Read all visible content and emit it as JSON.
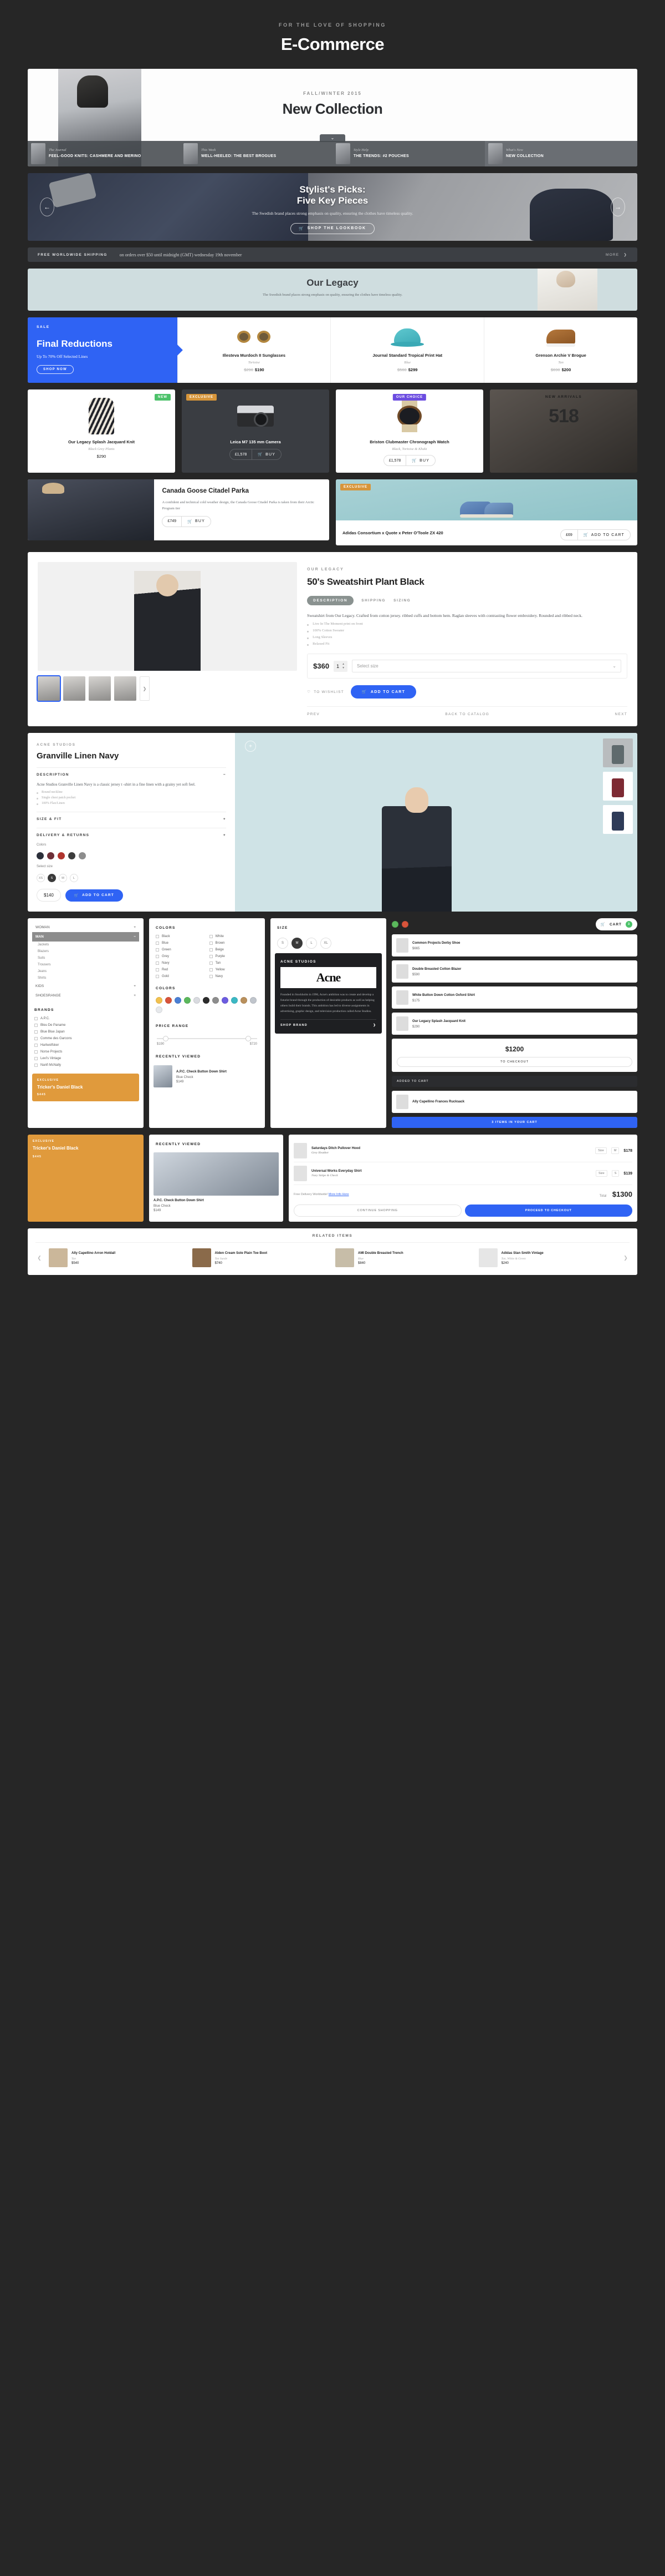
{
  "header": {
    "kicker": "FOR THE LOVE OF SHOPPING",
    "title": "E-Commerce"
  },
  "hero": {
    "kicker": "FALL/WINTER 2015",
    "title": "New Collection",
    "chevron": "⌄",
    "cards": [
      {
        "kicker": "The Journal",
        "title": "FEEL-GOOD KNITS: CASHMERE AND MERINO"
      },
      {
        "kicker": "This Week",
        "title": "WELL-HEELED: THE BEST BROGUES"
      },
      {
        "kicker": "Style Help",
        "title": "THE TRENDS: #2 POUCHES"
      },
      {
        "kicker": "What's New",
        "title": "NEW COLLECTION"
      }
    ]
  },
  "slider": {
    "title_line1": "Stylist's Picks:",
    "title_line2": "Five Key Pieces",
    "body": "The Swedish brand places strong emphasis on quality, ensuring the clothes have timeless quality.",
    "button": "SHOP THE LOOKBOOK",
    "prev": "←",
    "next": "→"
  },
  "shipping": {
    "strong": "FREE WORLDWIDE SHIPPING",
    "text": "on orders over $50 until midnight (GMT) wednesday 19th november",
    "more": "MORE",
    "more_icon": "❯"
  },
  "legacy": {
    "title": "Our Legacy",
    "body": "The Swedish brand places strong emphasis on quality, ensuring the clothes have timeless quality."
  },
  "sale": {
    "tag": "SALE",
    "title": "Final Reductions",
    "subtitle": "Up To 70% Off Selected Lines",
    "button": "SHOP NOW",
    "items": [
      {
        "name": "Illesteva Murdoch II Sunglasses",
        "color": "Tortoise",
        "old": "$290",
        "price": "$190"
      },
      {
        "name": "Journal Standard Tropical Print Hat",
        "color": "Blue",
        "old": "$560",
        "price": "$299"
      },
      {
        "name": "Grenson Archie V Brogue",
        "color": "Tan",
        "old": "$690",
        "price": "$200"
      }
    ]
  },
  "grid": {
    "items": [
      {
        "badge": "NEW",
        "name": "Our Legacy Splash Jacquard Knit",
        "color": "Black Grey Plants",
        "price": "$290"
      },
      {
        "badge": "EXCLUSIVE",
        "name": "Leica M7 135 mm Camera",
        "price": "£1,578",
        "buy": "BUY"
      },
      {
        "badge": "OUR CHOICE",
        "name": "Briston Clubmaster Chronograph Watch",
        "color": "Black, Tortoise & Khaki",
        "price": "£1,578",
        "buy": "BUY"
      },
      {
        "badge": "NEW ARRIVALS",
        "number": "518"
      }
    ]
  },
  "features": {
    "parka": {
      "title": "Canada Goose Citadel Parka",
      "body": "A confident and technical cold weather design, the Canada Goose Citadel Parka is taken from their Arctic Program tier",
      "price": "£749",
      "buy": "BUY"
    },
    "adidas": {
      "badge": "EXCLUSIVE",
      "name": "Adidas Consortium x Quote x Peter O'Toole ZX 420",
      "price": "£69",
      "button": "ADD TO CART"
    }
  },
  "detail": {
    "kicker": "OUR LEGACY",
    "title": "50's Sweatshirt Plant Black",
    "tabs": [
      "DESCRIPTION",
      "SHIPPING",
      "SIZING"
    ],
    "description": "Sweatshirt from Our Legacy. Crafted from cotton jersey. ribbed cuffs and bottom hem. Raglan sleeves with contrasting flower embroidery. Rounded and ribbed neck.",
    "bullets": [
      "Live In The Moment print on front",
      "100% Cotton Sweater",
      "Long Sleeves",
      "Relaxed Fit"
    ],
    "price": "$360",
    "qty": "1",
    "size_placeholder": "Select size",
    "wishlist": "TO WISHLIST",
    "add_to_cart": "ADD TO CART",
    "prev": "PREV",
    "back": "BACK TO CATALOG",
    "next": "NEXT"
  },
  "detail2": {
    "kicker": "ACNE STUDIOS",
    "title": "Granville Linen Navy",
    "section_description": "DESCRIPTION",
    "description": "Acne Studios Granville Linen Navy is a classic jersey t -shirt in a fine linen with a grainy yet soft feel.",
    "bullets": [
      "Round neckline",
      "Single chest patch pocket",
      "100% Flax/Linen"
    ],
    "section_sizefit": "SIZE & FIT",
    "section_delivery": "DELIVERY & RETURNS",
    "colors_label": "Colors",
    "colors": [
      "#2b2f3a",
      "#6e3038",
      "#b0352e",
      "#3c3c3c",
      "#8d8d8d"
    ],
    "size_label": "Select size",
    "sizes": [
      "XS",
      "S",
      "M",
      "L"
    ],
    "selected_size": "S",
    "price": "$140",
    "add_to_cart": "ADD TO CART"
  },
  "filters": {
    "gender": [
      {
        "label": "WOMAN",
        "selected": false
      },
      {
        "label": "MAN",
        "selected": true
      }
    ],
    "man_subs": [
      "Jackets",
      "Blazers",
      "Suits",
      "Trousers",
      "Jeans",
      "Shirts"
    ],
    "more": [
      "KIDS",
      "SHOESRANGE"
    ],
    "brands_label": "BRANDS",
    "brands": [
      "A.P.C.",
      "Bleu De Paname",
      "Blue Blue Japan",
      "Comme des Garcons",
      "Hartwolfsker",
      "Norse Projects",
      "Levi's Vintage",
      "Nanfi McNally"
    ],
    "colors_label": "COLORS",
    "color_names_left": [
      "Black",
      "Blue",
      "Green",
      "Grey",
      "Navy",
      "Red",
      "Gold"
    ],
    "color_names_right": [
      "White",
      "Brown",
      "Beige",
      "Purple",
      "Tan",
      "Yellow",
      "Navy"
    ],
    "palette_label": "COLORS",
    "palette": [
      "#f2c14e",
      "#d8543b",
      "#4a7fd4",
      "#5bb85c",
      "#d9dbe0",
      "#2b2b2b",
      "#8d8d8d",
      "#6c5ce0",
      "#3bb8c4",
      "#b9905c",
      "#c0c5cc",
      "#e7e9ec"
    ],
    "price_label": "PRICE RANGE",
    "price_min": "$190",
    "price_max": "$720",
    "size_label": "SIZE",
    "sizes": [
      "S",
      "M",
      "L",
      "XL"
    ],
    "selected_size": "M",
    "recently_label": "RECENTLY VIEWED",
    "recent": {
      "name": "A.P.C. Check Button Down Shirt",
      "brand": "Blue Check",
      "price": "$149"
    },
    "promo": {
      "tag": "EXCLUSIVE",
      "name": "Tricker's Daniel Black",
      "price": "$445"
    }
  },
  "acne_brand": {
    "logo": "Acne",
    "kicker": "ACNE STUDIOS",
    "body": "Founded in Stockholm in 1996, Acne's ambition was to create and develop a futurist brand through the production of desirable products as well as helping others build their brands. This ambition has led to diverse assignments in advertising, graphic design, and television production called Acne Studios.",
    "button": "SHOP BRAND",
    "button_icon": "❯"
  },
  "cart_side": {
    "cart_label": "CART",
    "cart_count": "3",
    "items": [
      {
        "name": "Common Projects Derby Shoe",
        "price": "$665"
      },
      {
        "name": "Double Breasted Cotton Blazer",
        "price": "$590"
      },
      {
        "name": "White Button Down Cotton Oxford Shirt",
        "price": "$175"
      },
      {
        "name": "Our Legacy Splash Jacquard Knit",
        "price": "$290"
      }
    ],
    "total_label": "TO CHECKOUT",
    "total_value": "$1200",
    "checkout_note": "Ally Capellino Frances Rucksack",
    "added_label": "ADDED TO CART",
    "view_cart": "3 ITEMS IN YOUR CART",
    "view_cart_icon": "❯"
  },
  "cart_panel": {
    "rows": [
      {
        "name": "Saturdays Ditch Pullover Hood",
        "brand": "Grey Heather",
        "size_label": "Size",
        "size": "M",
        "price": "$178"
      },
      {
        "name": "Universal Works Everyday Shirt",
        "brand": "Navy Stripe & Check",
        "size_label": "Size",
        "size": "S",
        "price": "$139"
      }
    ],
    "delivery_note": "Free Delivery Worldwide!",
    "delivery_link": "More Info Here",
    "total_label": "Total",
    "total_value": "$1300",
    "continue": "CONTINUE SHOPPING",
    "checkout": "PROCEED TO CHECKOUT"
  },
  "related": {
    "title": "RELATED ITEMS",
    "prev": "❮",
    "next": "❯",
    "items": [
      {
        "name": "Ally Capellino Arron Holdall",
        "brand": "Tan",
        "price": "$540",
        "color": "#cbb79a"
      },
      {
        "name": "Alden Cream Sole Plain Toe Boot",
        "brand": "Tan Suede",
        "price": "$740",
        "color": "#8a6a4a"
      },
      {
        "name": "AMI Double Breasted Trench",
        "brand": "Blue",
        "price": "$840",
        "color": "#c7bda8"
      },
      {
        "name": "Adidas Stan Smith Vintage",
        "brand": "Tan, White & Green",
        "price": "$240",
        "color": "#e6e6e6"
      }
    ]
  }
}
